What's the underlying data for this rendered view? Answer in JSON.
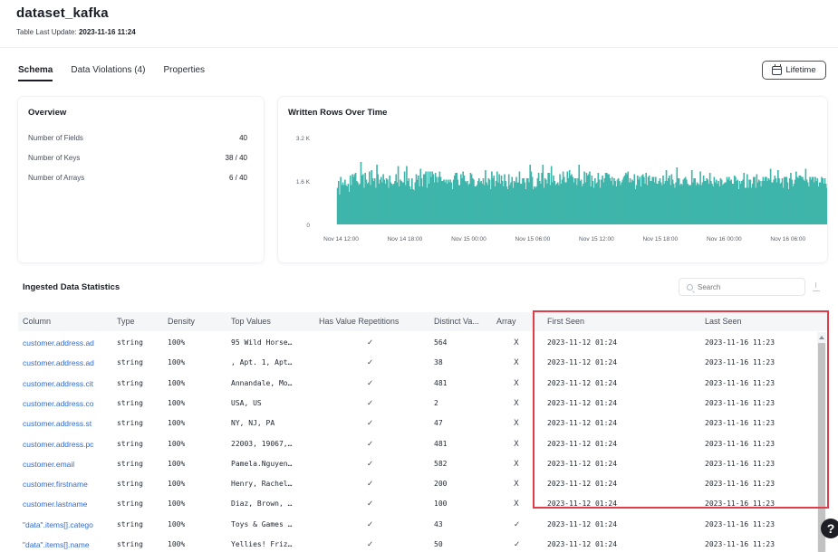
{
  "header": {
    "title": "dataset_kafka",
    "last_update_label": "Table Last Update:",
    "last_update_value": "2023-11-16 11:24"
  },
  "tabs": [
    {
      "label": "Schema",
      "active": true
    },
    {
      "label": "Data Violations (4)",
      "active": false
    },
    {
      "label": "Properties",
      "active": false
    }
  ],
  "lifetime_button": {
    "label": "Lifetime",
    "icon": "calendar-icon"
  },
  "overview": {
    "title": "Overview",
    "rows": [
      {
        "label": "Number of Fields",
        "value": "40"
      },
      {
        "label": "Number of Keys",
        "value": "38 / 40"
      },
      {
        "label": "Number of Arrays",
        "value": "6 / 40"
      }
    ]
  },
  "chart_data": {
    "type": "bar",
    "title": "Written Rows Over Time",
    "color": "#3fb5aa",
    "ylim": [
      0,
      3200
    ],
    "y_ticks": [
      {
        "value": 3200,
        "label": "3.2 K"
      },
      {
        "value": 1600,
        "label": "1.6 K"
      },
      {
        "value": 0,
        "label": "0"
      }
    ],
    "x_ticks": [
      "Nov 14 12:00",
      "Nov 14 18:00",
      "Nov 15 00:00",
      "Nov 15 06:00",
      "Nov 15 12:00",
      "Nov 15 18:00",
      "Nov 16 00:00",
      "Nov 16 06:00"
    ],
    "x_range_hours": [
      -2,
      45
    ],
    "x_tick_hours": [
      0,
      6,
      12,
      18,
      24,
      30,
      36,
      42
    ],
    "bar_start_hour": -0.4,
    "bar_step_hours": 0.1,
    "values": [
      1350,
      1600,
      1100,
      1750,
      1450,
      1550,
      1450,
      1650,
      1450,
      1400,
      1500,
      1200,
      1800,
      1450,
      1850,
      1750,
      1850,
      1900,
      1600,
      1550,
      1450,
      1500,
      2300,
      1800,
      1850,
      1350,
      1900,
      1650,
      1500,
      1550,
      1950,
      1450,
      2000,
      1700,
      1600,
      1700,
      1350,
      2200,
      1850,
      1500,
      1650,
      1750,
      1550,
      1850,
      1650,
      1500,
      1700,
      1650,
      1350,
      1800,
      1550,
      1500,
      1450,
      1500,
      1600,
      1850,
      1550,
      2150,
      1400,
      1650,
      1600,
      1550,
      1550,
      1950,
      1450,
      2150,
      1600,
      1700,
      1400,
      1300,
      1700,
      1300,
      1250,
      1550,
      1850,
      1650,
      1800,
      1400,
      2050,
      1700,
      1400,
      1850,
      1850,
      1950,
      1350,
      1950,
      1500,
      1950,
      1750,
      1950,
      1850,
      1550,
      1900,
      1750,
      1550,
      1750,
      1950,
      1750,
      1600,
      1600,
      1650,
      1550,
      1650,
      1500,
      1650,
      1550,
      1650,
      1550,
      1300,
      1650,
      1800,
      1900,
      1900,
      1650,
      1450,
      1450,
      1850,
      1700,
      1950,
      1800,
      1600,
      1550,
      1600,
      1450,
      1500,
      1900,
      1850,
      1700,
      1650,
      1400,
      1400,
      1450,
      1600,
      1700,
      1550,
      1600,
      1500,
      1700,
      1450,
      2000,
      1550,
      1450,
      1700,
      1650,
      1300,
      1950,
      1700,
      1800,
      1400,
      1600,
      1950,
      1550,
      1850,
      1500,
      1800,
      1600,
      1400,
      1850,
      1600,
      1400,
      1300,
      1850,
      1450,
      1550,
      1750,
      1350,
      1600,
      1550,
      1750,
      1550,
      1550,
      1950,
      1500,
      1500,
      1700,
      1700,
      1550,
      1300,
      1700,
      1700,
      1550,
      2200,
      1950,
      1750,
      1300,
      1400,
      1350,
      1400,
      1700,
      1900,
      1600,
      1500,
      1900,
      2200,
      1350,
      1700,
      1650,
      1500,
      1900,
      1900,
      1450,
      2150,
      1550,
      1800,
      1600,
      1450,
      1500,
      1550,
      1450,
      1850,
      1500,
      1650,
      1950,
      1750,
      1550,
      1550,
      1950,
      1700,
      2000,
      1800,
      1850,
      1750,
      1550,
      1700,
      1700,
      1450,
      1700,
      2200,
      1600,
      1650,
      1400,
      1500,
      1950,
      1550,
      1900,
      1800,
      1850,
      1950,
      1400,
      1800,
      1600,
      1350,
      1700,
      1500,
      1550,
      1900,
      1650,
      1350,
      1650,
      1800,
      1550,
      1700,
      1900,
      1900,
      1850,
      1850,
      1700,
      1600,
      1750,
      1450,
      1700,
      1600,
      1400,
      1650,
      1700,
      1600,
      1450,
      1550,
      1650,
      1750,
      1800,
      1900,
      1850,
      1950,
      1550,
      1700,
      1550,
      1650,
      1600,
      1850,
      1300,
      1450,
      1800,
      1650,
      1750,
      1400,
      1800,
      1850,
      1750,
      1500,
      1900,
      1450,
      1750,
      1800,
      1600,
      1600,
      1750,
      1750,
      1550,
      1750,
      1500,
      1500,
      1600,
      1700,
      1550,
      1450,
      1800,
      1500,
      1600,
      2000,
      1600,
      1700,
      1800,
      1450,
      1850,
      1650,
      1500,
      1350,
      1550,
      2100,
      1700,
      1700,
      1450,
      1500,
      1450,
      1650,
      1700,
      1750,
      1650,
      1500,
      1450,
      1450,
      1450,
      2000,
      1550,
      1700,
      1700,
      1450,
      1550,
      1500,
      1450,
      1950,
      1450,
      1550,
      1800,
      1600,
      1600,
      1700,
      1650,
      1500,
      1900,
      1600,
      1500,
      1400,
      1750,
      1550,
      1650,
      1500,
      1600,
      1400,
      1700,
      1650,
      1450,
      1500,
      1550,
      1550,
      1750,
      1650,
      1750,
      1600,
      1650,
      1500,
      1500,
      1800,
      1750,
      1600,
      1650,
      1300,
      1600,
      1500,
      1600,
      1650,
      1900,
      1350,
      1350,
      1850,
      1350,
      1650,
      1650,
      1350,
      1500,
      1750,
      1750,
      1350,
      1850,
      1550,
      1650,
      1600,
      1400,
      1600,
      1750,
      1600,
      1750,
      1750,
      1600,
      1700,
      1650,
      2050,
      1550,
      1550,
      1650,
      1800,
      1700,
      1550,
      2000,
      1700,
      1500,
      1550,
      1700,
      1350,
      1750,
      1750,
      1750,
      1550,
      1300,
      1700,
      1900,
      1650,
      1400,
      1500,
      1650,
      1950,
      1750,
      1700,
      1800,
      1800,
      1750,
      1750,
      1650,
      1600,
      2050,
      1650,
      1550,
      1400,
      1750,
      1650,
      1750,
      1750,
      1550,
      1750,
      1600,
      1700,
      1400,
      1550,
      1550,
      1750,
      1700,
      1500,
      1700,
      1500,
      1350,
      1800,
      1850,
      1650,
      1850,
      1600,
      1750,
      1650,
      1700,
      1500,
      1500,
      1700,
      1750,
      1650,
      1750,
      1700,
      1950,
      1650,
      1450,
      1600,
      1500,
      1600,
      1750,
      1300,
      1800,
      1700,
      1500,
      1500,
      1600,
      1950,
      1550,
      1700,
      1500,
      1400,
      1900,
      1850,
      1550,
      1850,
      1800,
      1650,
      1400,
      1750,
      1700,
      1750,
      1350,
      1500,
      1500,
      1650,
      1800,
      1750,
      1500,
      1650,
      1950,
      1700,
      1850,
      1500,
      1400,
      1700,
      1750,
      1600,
      1550,
      1500,
      1550,
      1600,
      1450,
      1550,
      1700,
      1750,
      1400,
      1650,
      1500,
      1600,
      1700,
      1700,
      1700,
      1750,
      1850,
      1750,
      1550,
      1700,
      1750,
      1650,
      1800,
      1600,
      1450,
      1500,
      1400,
      1650,
      1850,
      1600,
      1750,
      1600,
      1650,
      1300,
      1650,
      1400,
      1650,
      1500,
      1500,
      1650,
      1750,
      1550,
      1400,
      1650,
      1650,
      1550,
      1800,
      1550,
      1550,
      1550,
      1600,
      1650,
      1650,
      1550,
      1700,
      1650,
      1650,
      1600,
      1600,
      1700,
      1650,
      1550,
      1550,
      1350,
      1700,
      1700,
      1650,
      1550,
      1650,
      1450,
      1450,
      1700,
      1850,
      1750,
      1600,
      1550,
      1600,
      1650,
      1750,
      1400,
      1700,
      1500,
      1800,
      1600,
      1700,
      1700,
      1500,
      1600,
      1600,
      1750,
      1400,
      1750,
      1650,
      1500,
      1650,
      1500,
      1700,
      1650,
      1750,
      1600,
      1700,
      1550,
      1450,
      1550,
      1800,
      1800,
      1700,
      1450,
      1550,
      1500,
      1650,
      1650,
      1650,
      1550,
      1800,
      1700,
      1750,
      1650,
      1550,
      1600,
      1750,
      1350,
      1600,
      1600,
      1350,
      1500,
      1600,
      1450,
      1750,
      1500,
      1550,
      1650,
      1650,
      1600,
      1550,
      1700,
      1650,
      1600,
      1500,
      1550,
      1650,
      1500,
      1800,
      1650,
      1650,
      1600,
      1750,
      1650,
      1350,
      1700,
      1600,
      1750,
      1350,
      1700,
      1600,
      1600,
      1750,
      1500,
      1550,
      1450,
      1700,
      1450,
      1700,
      1600,
      1650,
      1750,
      1650,
      1600,
      1600,
      1700,
      1550,
      1500,
      1550,
      1700,
      1750,
      1650,
      1650,
      1500,
      1600,
      1800,
      1450,
      1700,
      1750,
      1650,
      1450,
      1550,
      1800,
      1550,
      1750,
      1750,
      1600,
      1700,
      1600,
      1650,
      1500,
      1500,
      1500,
      1450,
      1700,
      1800,
      1600,
      1550,
      1550,
      1500,
      1500,
      1500,
      1550,
      1800,
      1700,
      1350,
      1650,
      1750,
      1650,
      1500,
      1650,
      1700,
      1600,
      1700,
      1550,
      1750,
      1650,
      1400,
      1550,
      1550,
      1500,
      1550,
      1600,
      1700,
      1600,
      1600,
      1450,
      1700,
      1600,
      1600,
      1650,
      1550,
      1600,
      1700,
      1550,
      1650,
      1500,
      1650,
      1450,
      1700,
      1800,
      1600,
      1700,
      1450,
      1500,
      1550,
      1600,
      1650,
      1650,
      1650,
      1350,
      1500,
      1650,
      1700,
      1650,
      1650,
      1550,
      1650,
      1800,
      1650,
      1550,
      1600,
      1600,
      1650,
      1550,
      1600,
      1550,
      1500,
      1650,
      1750,
      1600,
      1550,
      1500,
      1600,
      1800,
      1700,
      1700,
      1550,
      1650,
      1550,
      1650,
      1500,
      1600,
      1700,
      1550,
      1500,
      1600,
      1600,
      1650,
      1500,
      1750,
      1700,
      1550,
      1550,
      1650,
      1650,
      1600,
      1650,
      1800,
      1600,
      1600,
      1700,
      1650,
      1550,
      1600,
      1450,
      1700,
      1600,
      1650,
      1700,
      1550,
      1600,
      1650,
      1550,
      1550,
      1700,
      1700,
      1550,
      1650,
      1650,
      1700,
      1550,
      1650,
      1600,
      1650,
      1600,
      1600,
      1650,
      1650,
      1550,
      1700,
      1550,
      1650,
      1600,
      1600,
      1550,
      1600,
      1600,
      1700,
      1600,
      1600,
      1650,
      1550,
      1700,
      1650,
      1600,
      1600,
      1650,
      1550,
      1600,
      1600,
      1650,
      1600,
      1600,
      1550,
      1600,
      1650,
      1600,
      1600,
      1650,
      1600,
      1600,
      1600,
      1550,
      1650,
      1600,
      1650,
      1600,
      1600,
      1650,
      1600,
      1600,
      1600,
      1600,
      1650,
      1600,
      1600
    ]
  },
  "stats": {
    "title": "Ingested Data Statistics",
    "search_placeholder": "Search",
    "columns": [
      "Column",
      "Type",
      "Density",
      "Top Values",
      "Has Value Repetitions",
      "Distinct Va...",
      "Array",
      "First Seen",
      "Last Seen"
    ],
    "rows": [
      {
        "column": "customer.address.ad",
        "type": "string",
        "density": "100%",
        "top": "95 Wild Horse…",
        "rep": "✓",
        "distinct": "564",
        "array": "X",
        "first": "2023-11-12 01:24",
        "last": "2023-11-16 11:23"
      },
      {
        "column": "customer.address.ad",
        "type": "string",
        "density": "100%",
        "top": ", Apt. 1, Apt…",
        "rep": "✓",
        "distinct": "38",
        "array": "X",
        "first": "2023-11-12 01:24",
        "last": "2023-11-16 11:23"
      },
      {
        "column": "customer.address.cit",
        "type": "string",
        "density": "100%",
        "top": "Annandale, Mo…",
        "rep": "✓",
        "distinct": "481",
        "array": "X",
        "first": "2023-11-12 01:24",
        "last": "2023-11-16 11:23"
      },
      {
        "column": "customer.address.co",
        "type": "string",
        "density": "100%",
        "top": "USA, US",
        "rep": "✓",
        "distinct": "2",
        "array": "X",
        "first": "2023-11-12 01:24",
        "last": "2023-11-16 11:23"
      },
      {
        "column": "customer.address.st",
        "type": "string",
        "density": "100%",
        "top": "NY, NJ, PA",
        "rep": "✓",
        "distinct": "47",
        "array": "X",
        "first": "2023-11-12 01:24",
        "last": "2023-11-16 11:23"
      },
      {
        "column": "customer.address.pc",
        "type": "string",
        "density": "100%",
        "top": "22003, 19067,…",
        "rep": "✓",
        "distinct": "481",
        "array": "X",
        "first": "2023-11-12 01:24",
        "last": "2023-11-16 11:23"
      },
      {
        "column": "customer.email",
        "type": "string",
        "density": "100%",
        "top": "Pamela.Nguyen…",
        "rep": "✓",
        "distinct": "582",
        "array": "X",
        "first": "2023-11-12 01:24",
        "last": "2023-11-16 11:23"
      },
      {
        "column": "customer.firstname",
        "type": "string",
        "density": "100%",
        "top": "Henry, Rachel…",
        "rep": "✓",
        "distinct": "200",
        "array": "X",
        "first": "2023-11-12 01:24",
        "last": "2023-11-16 11:23"
      },
      {
        "column": "customer.lastname",
        "type": "string",
        "density": "100%",
        "top": "Diaz, Brown, …",
        "rep": "✓",
        "distinct": "100",
        "array": "X",
        "first": "2023-11-12 01:24",
        "last": "2023-11-16 11:23"
      },
      {
        "column": "\"data\".items[].catego",
        "type": "string",
        "density": "100%",
        "top": "Toys & Games …",
        "rep": "✓",
        "distinct": "43",
        "array": "✓",
        "first": "2023-11-12 01:24",
        "last": "2023-11-16 11:23"
      },
      {
        "column": "\"data\".items[].name",
        "type": "string",
        "density": "100%",
        "top": "Yellies! Friz…",
        "rep": "✓",
        "distinct": "50",
        "array": "✓",
        "first": "2023-11-12 01:24",
        "last": "2023-11-16 11:23"
      }
    ]
  },
  "help_button": {
    "label": "?"
  }
}
